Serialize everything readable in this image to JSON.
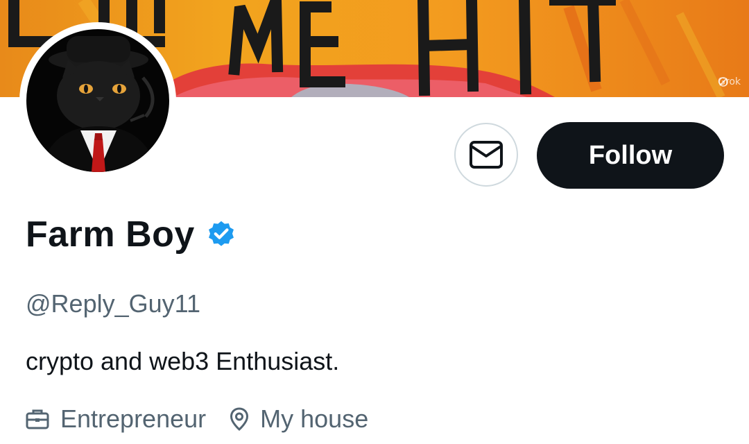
{
  "banner": {
    "watermark": "Grok",
    "painted_text": "LET ME HIT"
  },
  "profile": {
    "display_name": "Farm Boy",
    "verified": true,
    "handle": "@Reply_Guy11",
    "bio": "crypto and web3 Enthusiast.",
    "profession": "Entrepreneur",
    "location": "My house"
  },
  "actions": {
    "follow_label": "Follow",
    "message_icon": "mail-icon"
  },
  "colors": {
    "follow_bg": "#0f1419",
    "verified_badge": "#1d9bf0",
    "secondary_text": "#536471",
    "banner_orange": "#f2a41e"
  },
  "icons": {
    "profession": "briefcase-icon",
    "location": "location-pin-icon",
    "verified": "verified-badge-icon"
  }
}
